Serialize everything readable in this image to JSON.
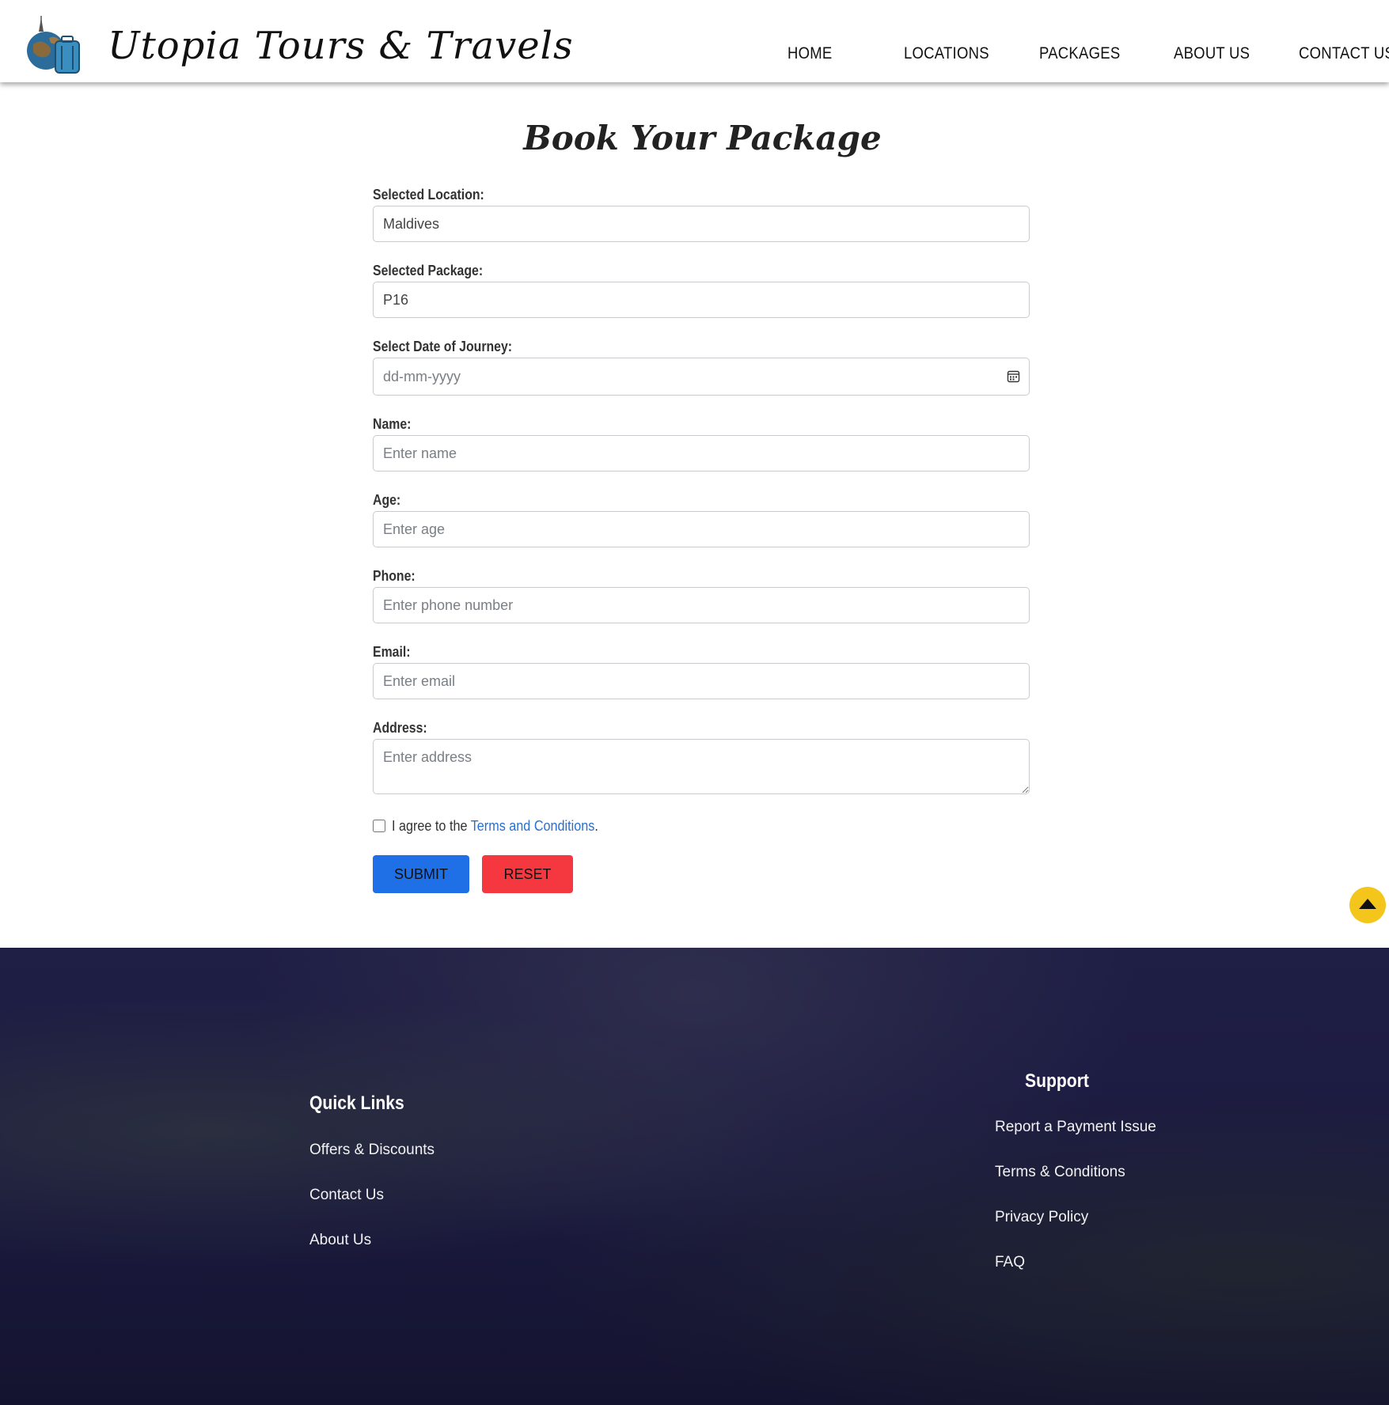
{
  "header": {
    "brand": "Utopia Tours & Travels",
    "nav": [
      "HOME",
      "LOCATIONS",
      "PACKAGES",
      "ABOUT US",
      "CONTACT US"
    ]
  },
  "main": {
    "title": "Book Your Package",
    "fields": {
      "location": {
        "label": "Selected Location:",
        "value": "Maldives"
      },
      "package": {
        "label": "Selected Package:",
        "value": "P16"
      },
      "date": {
        "label": "Select Date of Journey:",
        "placeholder": "dd-mm-yyyy",
        "icon": "calendar-icon"
      },
      "name": {
        "label": "Name:",
        "placeholder": "Enter name"
      },
      "age": {
        "label": "Age:",
        "placeholder": "Enter age"
      },
      "phone": {
        "label": "Phone:",
        "placeholder": "Enter phone number"
      },
      "email": {
        "label": "Email:",
        "placeholder": "Enter email"
      },
      "address": {
        "label": "Address:",
        "placeholder": "Enter address"
      }
    },
    "terms": {
      "prefix": "I agree to the ",
      "link": "Terms and Conditions",
      "suffix": "."
    },
    "submit_label": "SUBMIT",
    "reset_label": "RESET",
    "colors": {
      "submit": "#1f6fe6",
      "reset": "#f5383f",
      "to_top": "#f4c51b",
      "link": "#2a6fcc"
    }
  },
  "footer": {
    "quick_links": {
      "title": "Quick Links",
      "items": [
        "Offers & Discounts",
        "Contact Us",
        "About Us"
      ]
    },
    "support": {
      "title": "Support",
      "items": [
        "Report a Payment Issue",
        "Terms & Conditions",
        "Privacy Policy",
        "FAQ"
      ]
    },
    "background": "#1d1c42"
  }
}
